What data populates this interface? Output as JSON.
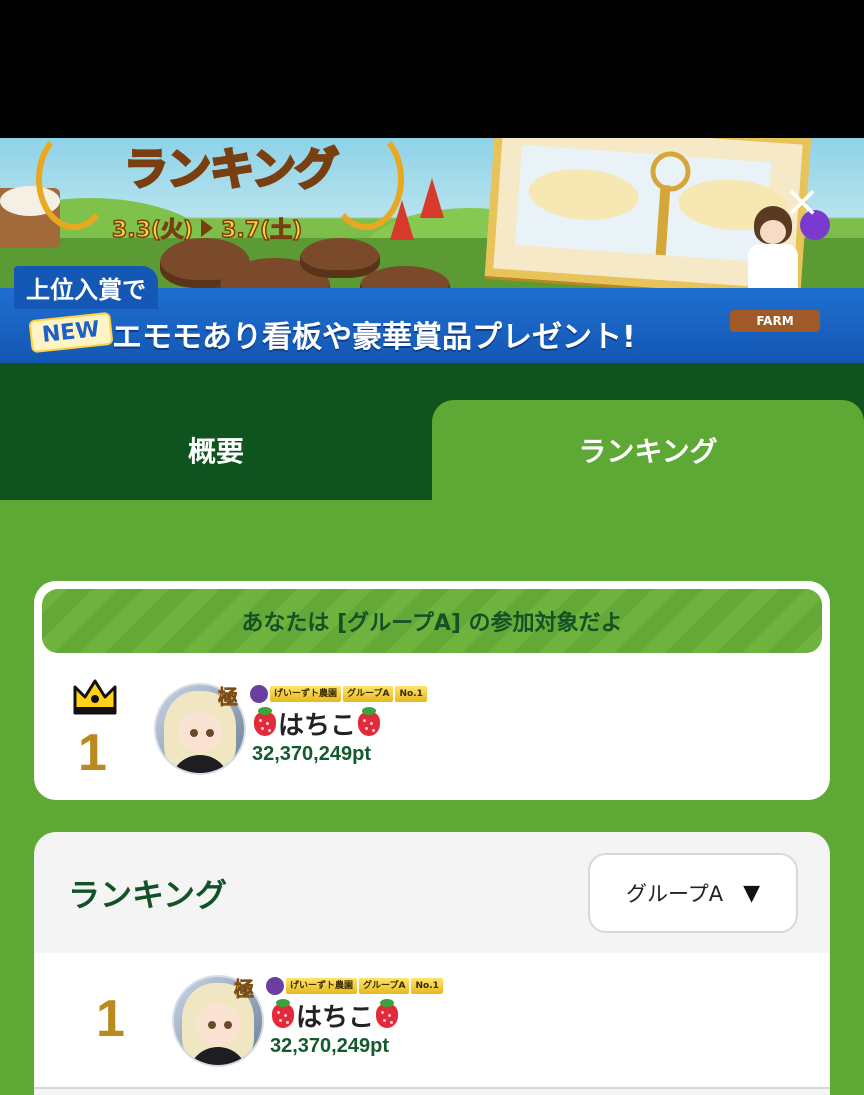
{
  "banner": {
    "title": "ランキング",
    "date_start": "3.3(火)",
    "date_end": "3.7(土)",
    "subtitle": "上位入賞で",
    "new_badge": "NEW",
    "headline": "エモモあり看板や豪華賞品プレゼント!",
    "farm_sign": "FARM",
    "close_icon": "close-icon"
  },
  "tabs": [
    {
      "label": "概要",
      "active": false
    },
    {
      "label": "ランキング",
      "active": true
    }
  ],
  "my_rank": {
    "notice": "あなたは [グループA] の参加対象だよ",
    "rank": "1",
    "crown_icon": "crown-icon",
    "kyoku": "極",
    "badge_text1": "げいーずト農園",
    "badge_text2": "グループA",
    "badge_text3": "No.1",
    "name": "はちこ",
    "points": "32,370,249pt"
  },
  "ranking": {
    "title": "ランキング",
    "group_select": "グループA",
    "select_arrow": "▼",
    "rows": [
      {
        "rank": "1",
        "kyoku": "極",
        "badge_text1": "げいーずト農園",
        "badge_text2": "グループA",
        "badge_text3": "No.1",
        "name": "はちこ",
        "points": "32,370,249pt"
      }
    ]
  },
  "colors": {
    "page_green": "#5ea935",
    "dark_green": "#0f541f",
    "text_green": "#135226",
    "gold": "#b98a20"
  }
}
